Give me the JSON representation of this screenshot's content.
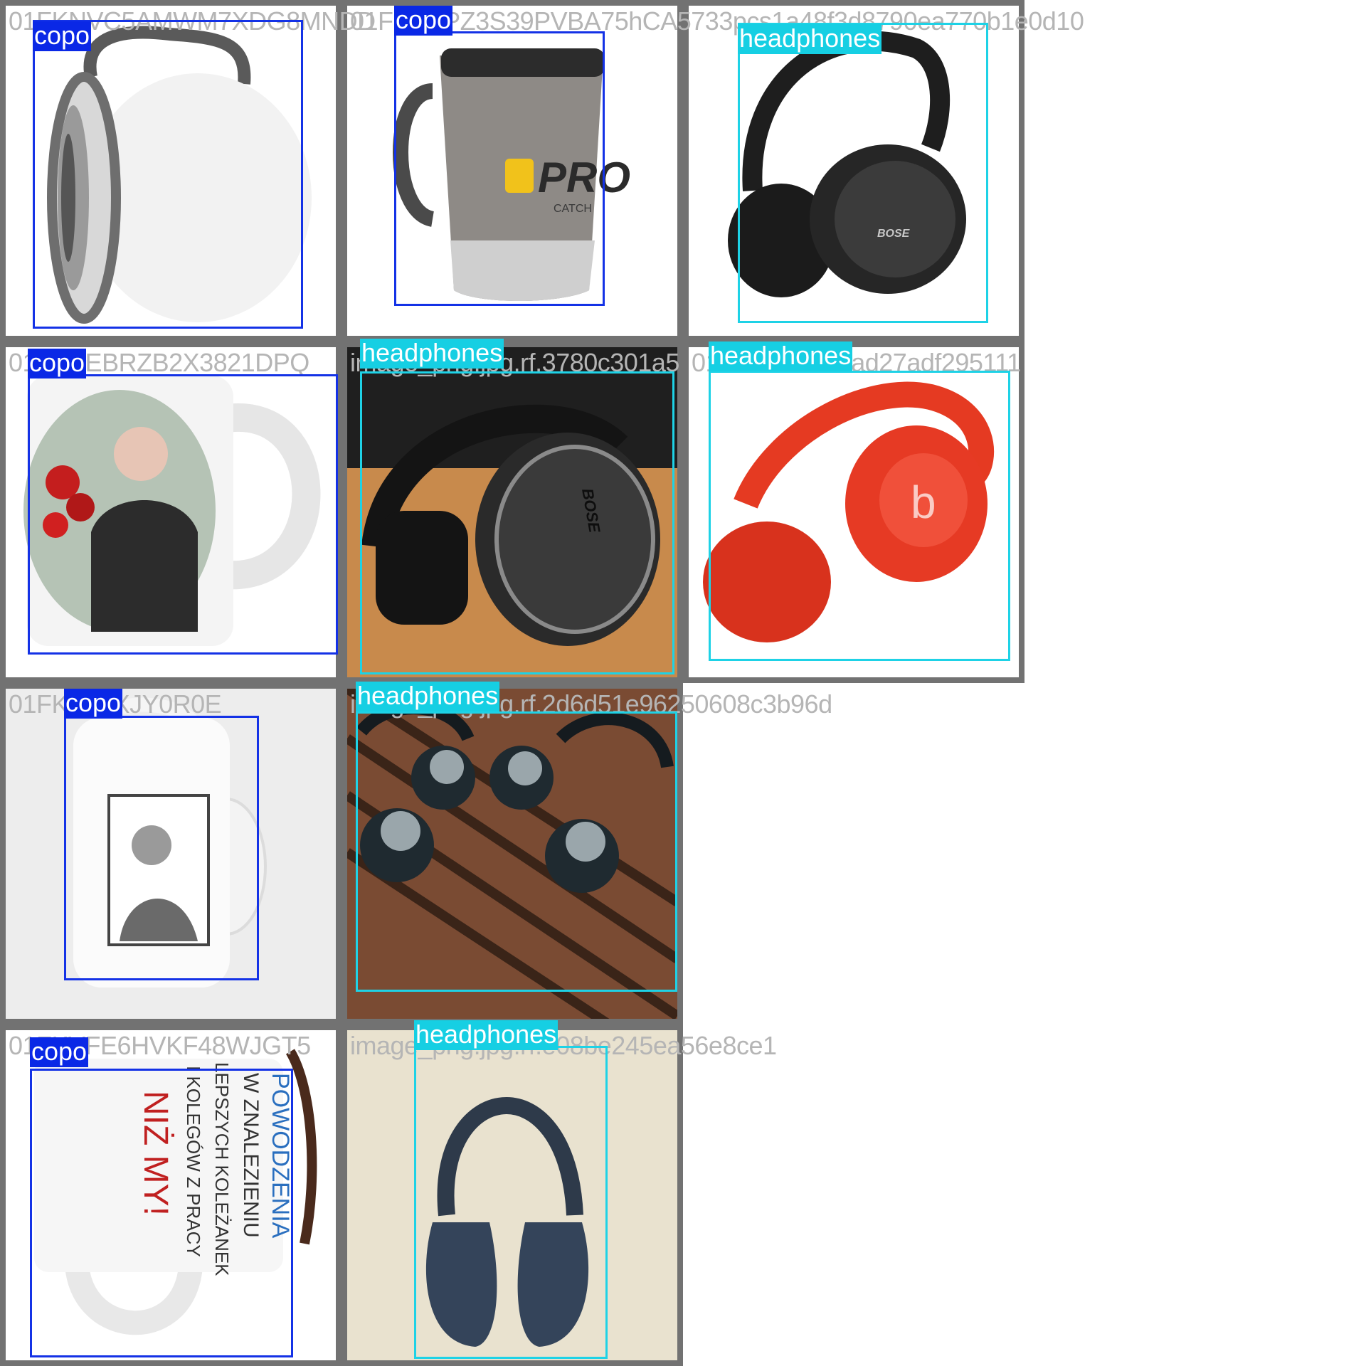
{
  "colors": {
    "copo": "#0a28e6",
    "headphones": "#16cfe3",
    "tile_border": "#727272",
    "filename_text": "#b5b5b5"
  },
  "tiles": [
    {
      "filename": "01FKNVC5AMWM7XDG8MNDD",
      "label": "copo"
    },
    {
      "filename": "01FKEEPZ3S39PVBA75hCA5733pcs1a48f3d8790ea770b1e0d10",
      "label": "copo"
    },
    {
      "filename": "",
      "label": "headphones"
    },
    {
      "filename": "01FKVEBRZB2X3821DPQ",
      "label": "copo"
    },
    {
      "filename": "image_png.jpg.rf.3780c301a5",
      "label": "headphones"
    },
    {
      "filename": "01f19e60a548ad27adf295111",
      "label": "headphones"
    },
    {
      "filename": "01FKY03XJY0R0E",
      "label": "copo"
    },
    {
      "filename": "image_png.jpg.rf.2d6d51e96250608c3b96d",
      "label": "headphones"
    },
    {
      "filename": "01FKVFE6HVKF48WJGT5",
      "label": "copo"
    },
    {
      "filename": "image_png.jpg.rf.e08be245ea56e8ce1",
      "label": "headphones"
    }
  ],
  "images": {
    "pro_mug_text": "PRO",
    "pro_mug_sub": "CATCH",
    "bose_logo": "BOSE",
    "beats_logo": "b",
    "mug_text_line1": "POWODZENIA",
    "mug_text_line2": "W ZNALEZIENIU",
    "mug_text_line3": "LEPSZYCH KOLEŻANEK",
    "mug_text_line4": "I KOLEGÓW Z PRACY",
    "mug_text_line5": "NIŻ MY!"
  }
}
